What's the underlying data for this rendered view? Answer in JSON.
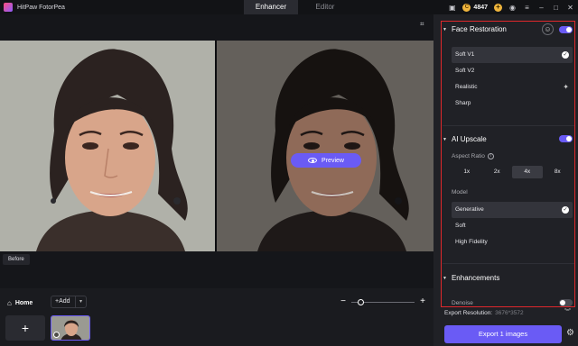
{
  "app": {
    "title": "HitPaw FotorPea"
  },
  "tabs": [
    {
      "label": "Enhancer",
      "active": true
    },
    {
      "label": "Editor",
      "active": false
    }
  ],
  "header": {
    "credits": "4847"
  },
  "canvas": {
    "before_label": "Before",
    "preview_label": "Preview"
  },
  "bottom": {
    "home_label": "Home",
    "add_label": "Add",
    "add_tile": "+",
    "zoom_minus": "−",
    "zoom_plus": "+",
    "zoom_level": 0.15
  },
  "panel": {
    "face_restoration": {
      "title": "Face Restoration",
      "enabled": true,
      "options": [
        {
          "label": "Soft V1",
          "selected": true
        },
        {
          "label": "Soft V2",
          "selected": false
        },
        {
          "label": "Realistic",
          "selected": false
        },
        {
          "label": "Sharp",
          "selected": false
        }
      ]
    },
    "ai_upscale": {
      "title": "AI Upscale",
      "enabled": true,
      "aspect_ratio_label": "Aspect Ratio",
      "ratios": [
        {
          "label": "1x",
          "selected": false
        },
        {
          "label": "2x",
          "selected": false
        },
        {
          "label": "4x",
          "selected": true
        },
        {
          "label": "8x",
          "selected": false
        }
      ],
      "model_label": "Model",
      "models": [
        {
          "label": "Generative",
          "selected": true
        },
        {
          "label": "Soft",
          "selected": false
        },
        {
          "label": "High Fidelity",
          "selected": false
        }
      ]
    },
    "enhancements": {
      "title": "Enhancements",
      "denoise_label": "Denoise",
      "denoise_enabled": false
    },
    "export_resolution_label": "Export Resolution:",
    "export_resolution_value": "3676*3572",
    "export_button": "Export 1 images"
  },
  "colors": {
    "accent": "#6a5bf5",
    "highlight_border": "#e0282c",
    "coin": "#f0b53d"
  },
  "icons": [
    "app-logo-icon",
    "chat-icon",
    "coin-icon",
    "plus-circle-icon",
    "user-icon",
    "menu-icon",
    "minimize-icon",
    "maximize-icon",
    "close-icon",
    "crop-icon",
    "eye-icon",
    "home-icon",
    "chevron-down-icon",
    "smile-icon",
    "sparkle-icon",
    "info-icon",
    "check-icon",
    "double-chevron-icon",
    "gear-icon"
  ]
}
